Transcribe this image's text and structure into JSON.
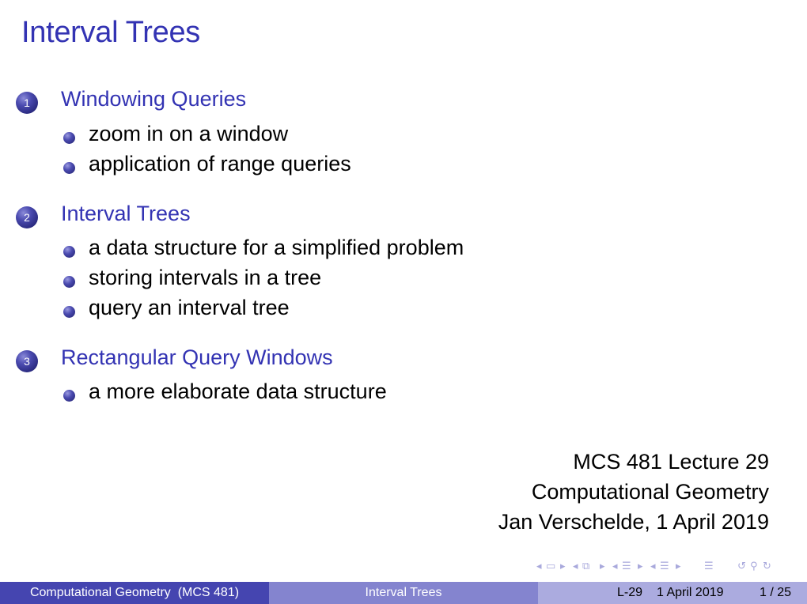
{
  "slide": {
    "title": "Interval Trees",
    "sections": [
      {
        "number": "1",
        "title": "Windowing Queries",
        "items": [
          "zoom in on a window",
          "application of range queries"
        ]
      },
      {
        "number": "2",
        "title": "Interval Trees",
        "items": [
          "a data structure for a simplified problem",
          "storing intervals in a tree",
          "query an interval tree"
        ]
      },
      {
        "number": "3",
        "title": "Rectangular Query Windows",
        "items": [
          "a more elaborate data structure"
        ]
      }
    ],
    "info_lines": [
      "MCS 481 Lecture 29",
      "Computational Geometry",
      "Jan Verschelde, 1 April 2019"
    ]
  },
  "nav_icons": [
    "prev-frame-icon",
    "frame-icon",
    "next-frame-icon",
    "prev-subsection-icon",
    "subsection-icon",
    "next-subsection-icon",
    "prev-section-icon",
    "section-icon",
    "next-section-icon",
    "prev-slide-icon",
    "slide-icon",
    "next-slide-icon",
    "align-icon",
    "back-icon",
    "search-icon",
    "forward-icon"
  ],
  "footer": {
    "course": "Computational Geometry  (MCS 481)",
    "title": "Interval Trees",
    "lecture": "L-29",
    "date": "1 April 2019",
    "page": "1 / 25"
  },
  "colors": {
    "accent": "#3333b3",
    "footer_dark": "#4545b0",
    "footer_mid": "#8484cf",
    "footer_light": "#ababdf"
  }
}
